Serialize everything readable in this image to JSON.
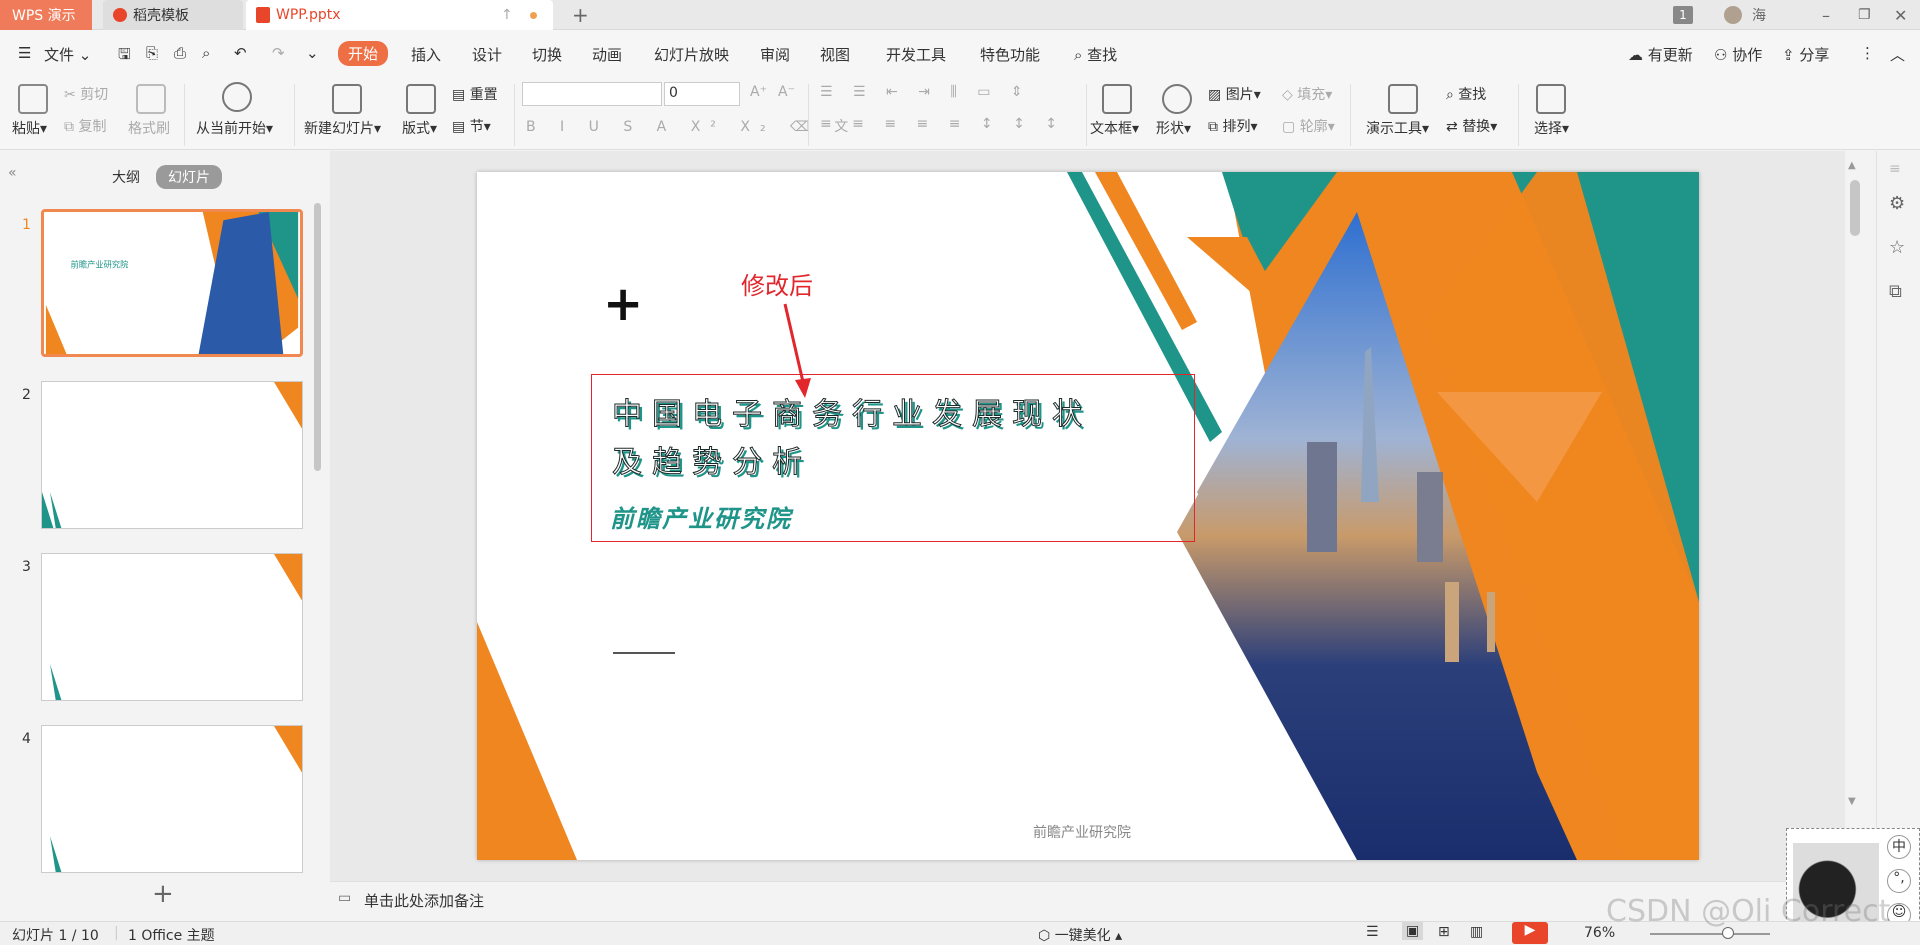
{
  "tabs": {
    "wps": "WPS 演示",
    "docer": "稻壳模板",
    "doc": "WPP.pptx",
    "user_badge": "1",
    "user_name": "海"
  },
  "menu": {
    "file": "文件",
    "items": [
      "开始",
      "插入",
      "设计",
      "切换",
      "动画",
      "幻灯片放映",
      "审阅",
      "视图",
      "开发工具",
      "特色功能"
    ],
    "search": "查找",
    "update": "有更新",
    "collab": "协作",
    "share": "分享"
  },
  "ribbon": {
    "paste": "粘贴",
    "cut": "剪切",
    "copy": "复制",
    "format_painter": "格式刷",
    "from_current": "从当前开始",
    "new_slide": "新建幻灯片",
    "layout": "版式",
    "reset": "重置",
    "section": "节",
    "font_size": "0",
    "textbox": "文本框",
    "shape": "形状",
    "picture": "图片",
    "fill": "填充",
    "arrange": "排列",
    "outline": "轮廓",
    "present_tools": "演示工具",
    "find": "查找",
    "replace": "替换",
    "select": "选择"
  },
  "panel": {
    "outline_tab": "大纲",
    "slides_tab": "幻灯片",
    "numbers": [
      "1",
      "2",
      "3",
      "4"
    ]
  },
  "slide": {
    "annotation": "修改后",
    "title_line1": "中国电子商务行业发展现状",
    "title_line2": "及趋势分析",
    "subtitle": "前瞻产业研究院",
    "footer": "前瞻产业研究院",
    "plus": "+"
  },
  "notes": {
    "placeholder": "单击此处添加备注"
  },
  "status": {
    "slide_count": "幻灯片 1 / 10",
    "theme": "1 Office 主题",
    "beautify": "一键美化",
    "zoom": "76%",
    "watermark": "CSDN @Oli Correct"
  },
  "colors": {
    "accent": "#ee6f44",
    "orange": "#ef861f",
    "teal": "#1f9589",
    "red": "#e1262c"
  }
}
